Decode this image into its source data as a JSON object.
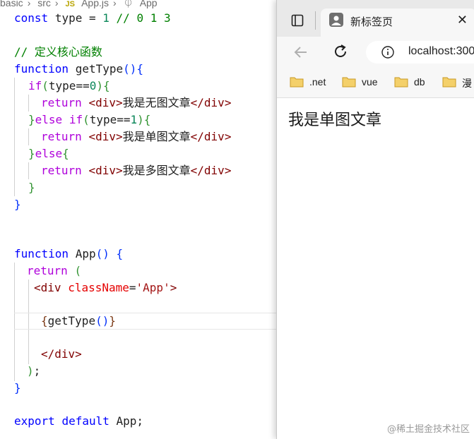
{
  "breadcrumb": [
    "basic",
    "src",
    "JS",
    "App.js",
    "App"
  ],
  "code": {
    "l1": [
      "const",
      "type",
      "=",
      "1",
      "// 0 1 3"
    ],
    "l3": "// 定义核心函数",
    "l4": [
      "function",
      "getType",
      "(){"
    ],
    "l5": [
      "if",
      "(",
      "type",
      "==",
      "0",
      "){"
    ],
    "l6": [
      "return",
      "<",
      "div",
      ">",
      "我是无图文章",
      "</",
      "div",
      ">"
    ],
    "l7": [
      "}",
      "else",
      "if",
      "(",
      "type",
      "==",
      "1",
      "){"
    ],
    "l8": [
      "return",
      "<",
      "div",
      ">",
      "我是单图文章",
      "</",
      "div",
      ">"
    ],
    "l9": [
      "}",
      "else",
      "{"
    ],
    "l10": [
      "return",
      "<",
      "div",
      ">",
      "我是多图文章",
      "</",
      "div",
      ">"
    ],
    "l11": "}",
    "l12": "}",
    "l15": [
      "function",
      "App",
      "()",
      "{"
    ],
    "l16": [
      "return",
      "("
    ],
    "l17": [
      "<",
      "div",
      "className",
      "=",
      "'App'",
      ">"
    ],
    "l19": [
      "{",
      "getType",
      "()",
      "}"
    ],
    "l21": [
      "</",
      "div",
      ">"
    ],
    "l22": [
      ")",
      ";"
    ],
    "l23": "}",
    "l25": [
      "export",
      "default",
      "App",
      ";"
    ]
  },
  "browser": {
    "tab_title": "新标签页",
    "url": "localhost:300",
    "bookmarks": [
      ".net",
      "vue",
      "db",
      "漫"
    ],
    "page_text": "我是单图文章"
  },
  "watermark": "@稀土掘金技术社区"
}
